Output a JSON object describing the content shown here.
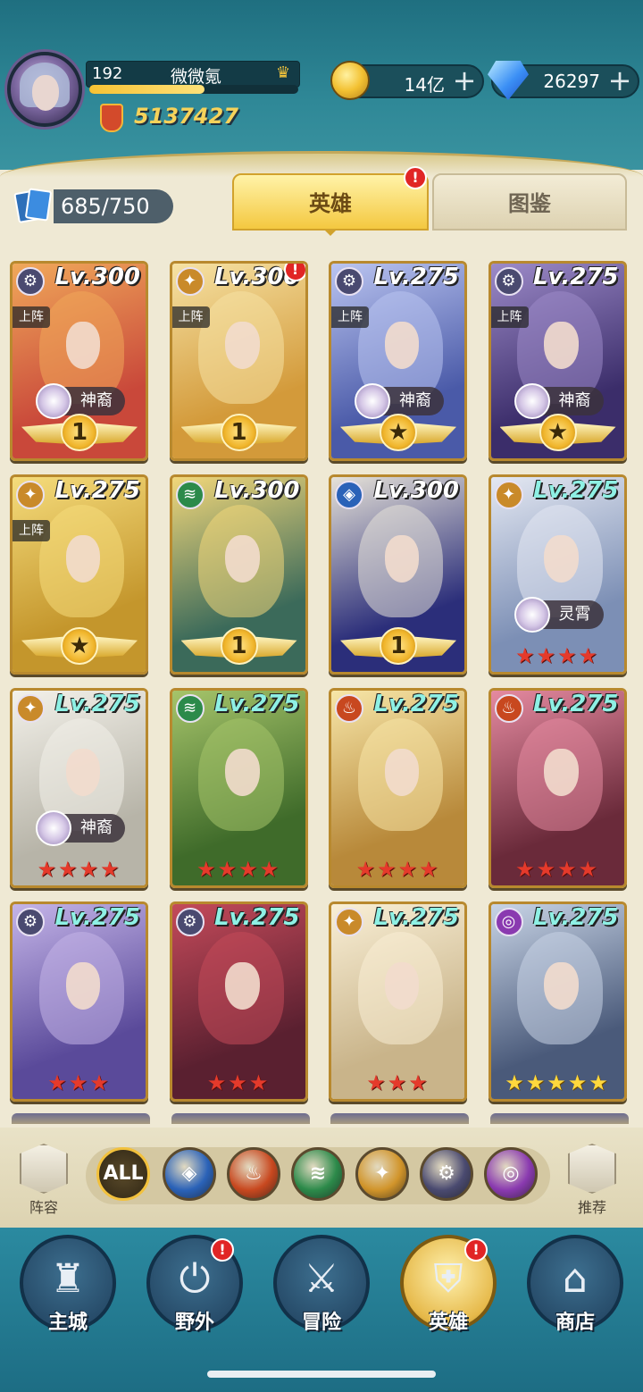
{
  "player": {
    "level": "192",
    "name": "微微氪",
    "xp_fraction": 0.55,
    "power": "5137427"
  },
  "currencies": {
    "gold": "14亿",
    "gems": "26297",
    "plus": "+"
  },
  "tabs": {
    "card_count": "685/750",
    "heroes": "英雄",
    "gallery": "图鉴",
    "badge": "!"
  },
  "heroes": [
    {
      "level": "Lv.300",
      "faction": "⚙",
      "faction_color": "#4a4a70",
      "deployed": "上阵",
      "tier": "神裔",
      "rank": "1",
      "stars": "",
      "art": [
        "#c9483a",
        "#f0a85a"
      ],
      "level_color": "white"
    },
    {
      "level": "Lv.300",
      "faction": "✦",
      "faction_color": "#c98a2a",
      "deployed": "上阵",
      "tier": "",
      "rank": "1",
      "stars": "",
      "art": [
        "#d39a3a",
        "#f6e2a4"
      ],
      "level_color": "white",
      "badge": "!"
    },
    {
      "level": "Lv.275",
      "faction": "⚙",
      "faction_color": "#4a4a70",
      "deployed": "上阵",
      "tier": "神裔",
      "rank": "★",
      "stars": "",
      "art": [
        "#4a5aa8",
        "#bac4f0"
      ],
      "level_color": "white"
    },
    {
      "level": "Lv.275",
      "faction": "⚙",
      "faction_color": "#4a4a70",
      "deployed": "上阵",
      "tier": "神裔",
      "rank": "★",
      "stars": "",
      "art": [
        "#3b2d6a",
        "#9c8ac8"
      ],
      "level_color": "white"
    },
    {
      "level": "Lv.275",
      "faction": "✦",
      "faction_color": "#c98a2a",
      "deployed": "上阵",
      "tier": "",
      "rank": "★",
      "stars": "",
      "art": [
        "#c4962c",
        "#f5dc7c"
      ],
      "level_color": "white"
    },
    {
      "level": "Lv.300",
      "faction": "≋",
      "faction_color": "#2c8a4a",
      "deployed": "",
      "tier": "",
      "rank": "1",
      "stars": "",
      "art": [
        "#3b6a5a",
        "#f2d77a"
      ],
      "level_color": "white"
    },
    {
      "level": "Lv.300",
      "faction": "◈",
      "faction_color": "#2a62b8",
      "deployed": "",
      "tier": "",
      "rank": "1",
      "stars": "",
      "art": [
        "#2b2e7a",
        "#e6e2d8"
      ],
      "level_color": "white"
    },
    {
      "level": "Lv.275",
      "faction": "✦",
      "faction_color": "#c98a2a",
      "deployed": "",
      "tier": "灵霄",
      "rank": "",
      "stars": "★★★★",
      "art": [
        "#7c8fb5",
        "#e4e8f2"
      ],
      "level_color": "teal"
    },
    {
      "level": "Lv.275",
      "faction": "✦",
      "faction_color": "#c98a2a",
      "deployed": "",
      "tier": "神裔",
      "rank": "",
      "stars": "★★★★",
      "art": [
        "#b7b4a8",
        "#f3f1ea"
      ],
      "level_color": "teal"
    },
    {
      "level": "Lv.275",
      "faction": "≋",
      "faction_color": "#2c8a4a",
      "deployed": "",
      "tier": "",
      "rank": "",
      "stars": "★★★★",
      "art": [
        "#3f6b2a",
        "#a6c46a"
      ],
      "level_color": "teal"
    },
    {
      "level": "Lv.275",
      "faction": "♨",
      "faction_color": "#c8481f",
      "deployed": "",
      "tier": "",
      "rank": "",
      "stars": "★★★★",
      "art": [
        "#b8893a",
        "#f7e6a8"
      ],
      "level_color": "teal"
    },
    {
      "level": "Lv.275",
      "faction": "♨",
      "faction_color": "#c8481f",
      "deployed": "",
      "tier": "",
      "rank": "",
      "stars": "★★★★",
      "art": [
        "#6a2a3a",
        "#e58aa0"
      ],
      "level_color": "teal"
    },
    {
      "level": "Lv.275",
      "faction": "⚙",
      "faction_color": "#4a4a70",
      "deployed": "",
      "tier": "",
      "rank": "",
      "stars": "★★★",
      "art": [
        "#5a4a9a",
        "#c4b4e8"
      ],
      "level_color": "teal"
    },
    {
      "level": "Lv.275",
      "faction": "⚙",
      "faction_color": "#4a4a70",
      "deployed": "",
      "tier": "",
      "rank": "",
      "stars": "★★★",
      "art": [
        "#5a2030",
        "#c44a5a"
      ],
      "level_color": "teal"
    },
    {
      "level": "Lv.275",
      "faction": "✦",
      "faction_color": "#c98a2a",
      "deployed": "",
      "tier": "",
      "rank": "",
      "stars": "★★★",
      "art": [
        "#c9b48a",
        "#f9efd6"
      ],
      "level_color": "teal"
    },
    {
      "level": "Lv.275",
      "faction": "◎",
      "faction_color": "#8a3ab0",
      "deployed": "",
      "tier": "",
      "rank": "",
      "stars": "★★★★★",
      "stars_gold": true,
      "art": [
        "#4a5a7a",
        "#c8d4e6"
      ],
      "level_color": "teal"
    }
  ],
  "filters": {
    "lineup": "阵容",
    "recommend": "推荐",
    "all": "ALL",
    "items": [
      {
        "name": "water",
        "glyph": "◈",
        "color": "#2a62b8"
      },
      {
        "name": "fire",
        "glyph": "♨",
        "color": "#c8481f"
      },
      {
        "name": "wind",
        "glyph": "≋",
        "color": "#2c8a4a"
      },
      {
        "name": "light",
        "glyph": "✦",
        "color": "#d1942a"
      },
      {
        "name": "dark",
        "glyph": "⚙",
        "color": "#4a4a70"
      },
      {
        "name": "void",
        "glyph": "◎",
        "color": "#8a3ab0"
      }
    ]
  },
  "nav": [
    {
      "label": "主城",
      "glyph": "♜",
      "active": false,
      "badge": ""
    },
    {
      "label": "野外",
      "glyph": "⏻",
      "active": false,
      "badge": "!"
    },
    {
      "label": "冒险",
      "glyph": "⚔",
      "active": false,
      "badge": ""
    },
    {
      "label": "英雄",
      "glyph": "⛨",
      "active": true,
      "badge": "!"
    },
    {
      "label": "商店",
      "glyph": "⌂",
      "active": false,
      "badge": ""
    }
  ]
}
